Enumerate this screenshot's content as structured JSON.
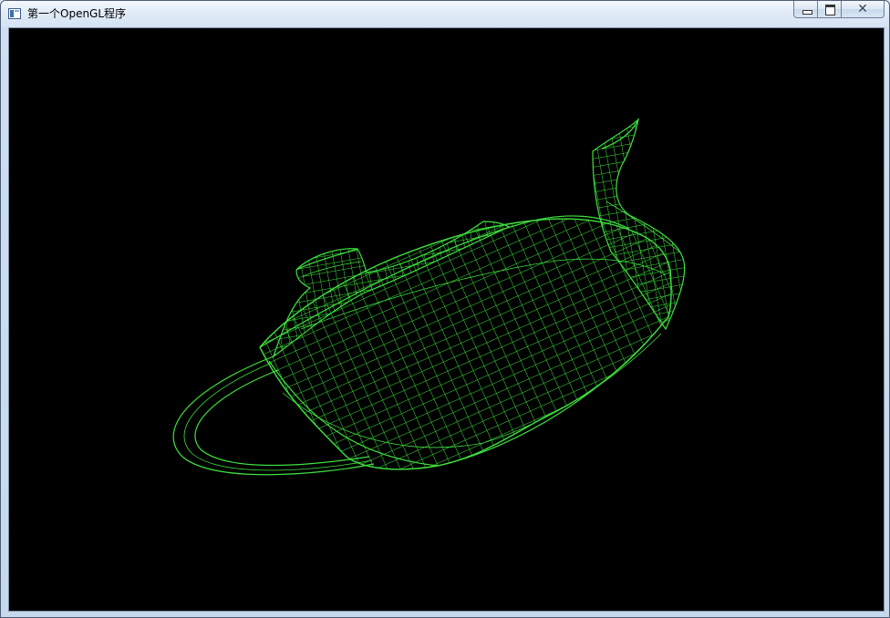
{
  "window": {
    "title": "第一个OpenGL程序",
    "icon": "app-window-icon"
  },
  "controls": {
    "minimize_icon": "minimize-icon",
    "maximize_icon": "maximize-icon",
    "close_glyph": "✕"
  },
  "viewport": {
    "background": "#000000",
    "model": "teapot",
    "render_mode": "wireframe",
    "wire_color": "#3ee13e"
  }
}
